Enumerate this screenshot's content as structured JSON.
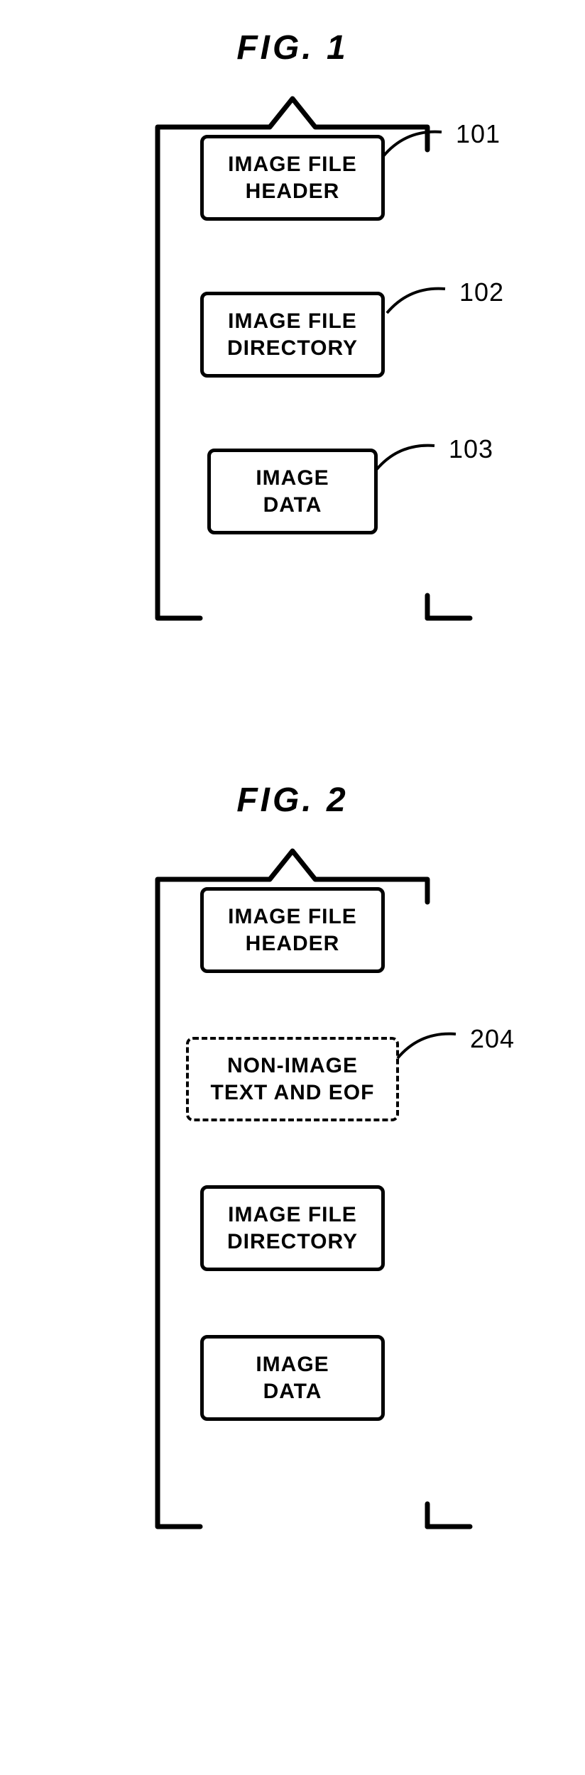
{
  "figures": [
    {
      "title": "FIG. 1",
      "blocks": [
        {
          "id": "fig1-header",
          "text": "IMAGE FILE\nHEADER",
          "ref": "101",
          "dashed": false
        },
        {
          "id": "fig1-directory",
          "text": "IMAGE FILE\nDIRECTORY",
          "ref": "102",
          "dashed": false
        },
        {
          "id": "fig1-data",
          "text": "IMAGE\nDATA",
          "ref": "103",
          "dashed": false
        }
      ]
    },
    {
      "title": "FIG. 2",
      "blocks": [
        {
          "id": "fig2-header",
          "text": "IMAGE FILE\nHEADER",
          "ref": null,
          "dashed": false
        },
        {
          "id": "fig2-nonimage",
          "text": "NON-IMAGE\nTEXT AND EOF",
          "ref": "204",
          "dashed": true
        },
        {
          "id": "fig2-directory",
          "text": "IMAGE FILE\nDIRECTORY",
          "ref": null,
          "dashed": false
        },
        {
          "id": "fig2-data",
          "text": "IMAGE\nDATA",
          "ref": null,
          "dashed": false
        }
      ]
    }
  ]
}
